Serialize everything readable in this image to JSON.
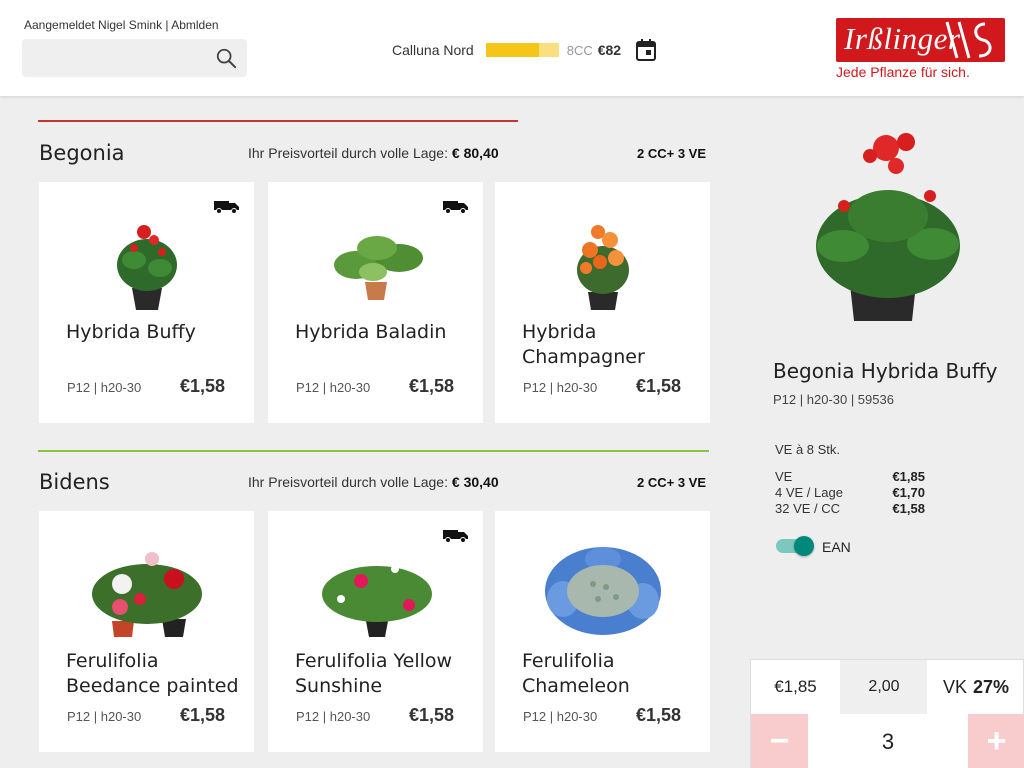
{
  "header": {
    "login_text": "Aangemeldet Nigel Smink | Abmlden",
    "search_placeholder": "",
    "location": "Calluna Nord",
    "progress_fraction": 0.73,
    "cc_label": "8CC",
    "cc_price": "€82",
    "logo_text": "Irßlinger",
    "logo_tagline": "Jede Pflanze für sich."
  },
  "colors": {
    "brand_red": "#d0181d",
    "begonia_divider": "#c0392b",
    "bidens_divider": "#8bc34a",
    "progress_fill": "#f5c518",
    "toggle_on": "#00897b",
    "stepper_bg": "#f8cccc"
  },
  "sections": [
    {
      "title": "Begonia",
      "advantage_label": "Ihr Preisvorteil durch volle Lage:",
      "advantage_value": "€ 80,40",
      "cc_info": "2 CC+ 3 VE",
      "products": [
        {
          "name": "Hybrida Buffy",
          "meta": "P12  |  h20-30",
          "price": "€1,58",
          "truck": true,
          "icon": "red-begonia"
        },
        {
          "name": "Hybrida Baladin",
          "meta": "P12  |  h20-30",
          "price": "€1,58",
          "truck": true,
          "icon": "green-begonia"
        },
        {
          "name": "Hybrida Champagner",
          "meta": "P12  |  h20-30",
          "price": "€1,58",
          "truck": false,
          "icon": "orange-begonia"
        }
      ]
    },
    {
      "title": "Bidens",
      "advantage_label": "Ihr Preisvorteil durch volle Lage:",
      "advantage_value": "€ 30,40",
      "cc_info": "2 CC+ 3 VE",
      "products": [
        {
          "name": "Ferulifolia Beedance painted",
          "meta": "P12  |  h20-30",
          "price": "€1,58",
          "truck": false,
          "icon": "hibiscus-mix"
        },
        {
          "name": "Ferulifolia Yellow Sunshine",
          "meta": "P12  |  h20-30",
          "price": "€1,58",
          "truck": true,
          "icon": "pink-flowers"
        },
        {
          "name": "Ferulifolia Chameleon",
          "meta": "P12  |  h20-30",
          "price": "€1,58",
          "truck": false,
          "icon": "blue-hydrangea"
        }
      ]
    }
  ],
  "detail": {
    "title": "Begonia Hybrida Buffy",
    "meta": "P12  |  h20-30 |  59536",
    "ve_info": "VE à 8 Stk.",
    "prices": [
      {
        "label": "VE",
        "value": "€1,85"
      },
      {
        "label": "4 VE / Lage",
        "value": "€1,70"
      },
      {
        "label": "32 VE / CC",
        "value": "€1,58"
      }
    ],
    "ean_label": "EAN",
    "ean_on": true
  },
  "order": {
    "price": "€1,85",
    "factor": "2,00",
    "vk_label": "VK",
    "vk_value": "27%",
    "minus": "−",
    "quantity": "3",
    "plus": "+"
  }
}
